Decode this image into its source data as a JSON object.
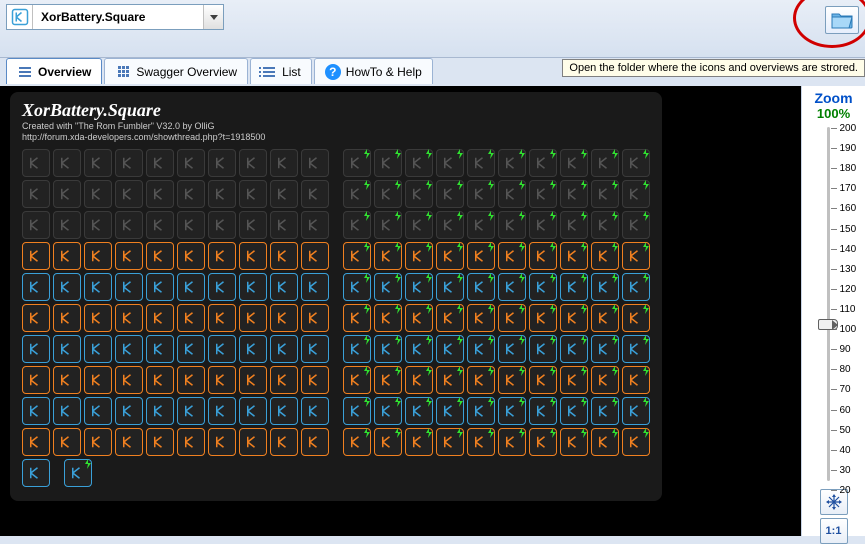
{
  "header": {
    "dropdown_text": "XorBattery.Square",
    "folder_tooltip": "Open the folder where the icons and overviews are strored."
  },
  "tabs": [
    {
      "label": "Overview",
      "active": true,
      "icon": "lines"
    },
    {
      "label": "Swagger Overview",
      "active": false,
      "icon": "grid"
    },
    {
      "label": "List",
      "active": false,
      "icon": "list"
    },
    {
      "label": "HowTo & Help",
      "active": false,
      "icon": "help"
    }
  ],
  "preview": {
    "title": "XorBattery.Square",
    "created": "Created with \"The Rom Fumbler\" V32.0 by OlliG",
    "url": "http://forum.xda-developers.com/showthread.php?t=1918500",
    "row_styles": [
      "dark",
      "dark",
      "dark",
      "orange",
      "blue",
      "orange",
      "blue",
      "orange",
      "blue",
      "orange",
      "blue"
    ],
    "cols_per_half": 10,
    "right_has_bolt": true
  },
  "zoom": {
    "title": "Zoom",
    "percent": "100%",
    "ticks": [
      "200",
      "190",
      "180",
      "170",
      "160",
      "150",
      "140",
      "130",
      "120",
      "110",
      "100",
      "90",
      "80",
      "70",
      "60",
      "50",
      "40",
      "30",
      "20"
    ],
    "thumb_value": "100",
    "btn_fit_icon": "arrows-cross",
    "btn_ratio_label": "1:1"
  }
}
